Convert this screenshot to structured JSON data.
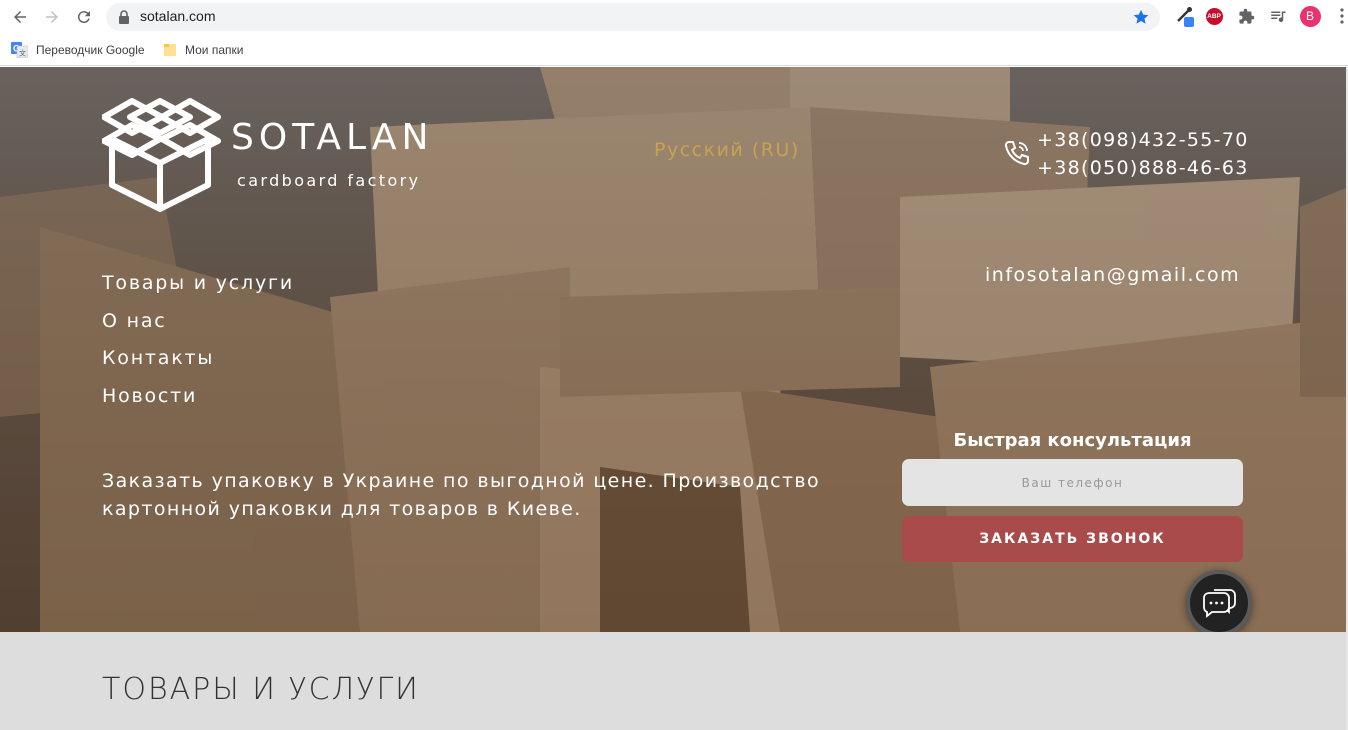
{
  "browser": {
    "url": "sotalan.com",
    "avatar_letter": "B",
    "abp_label": "ABP",
    "bookmarks": [
      {
        "label": "Переводчик Google",
        "icon": "google-translate-icon"
      },
      {
        "label": "Мои папки",
        "icon": "folder-icon"
      }
    ]
  },
  "site": {
    "logo_name": "SOTALAN",
    "logo_tagline": "cardboard factory",
    "language": "Русский (RU)",
    "phones": [
      "+38(098)432-55-70",
      "+38(050)888-46-63"
    ],
    "email": "infosotalan@gmail.com",
    "menu": [
      "Товары и услуги",
      "О нас",
      "Контакты",
      "Новости"
    ],
    "tagline": "Заказать упаковку в Украине по выгодной цене. Производство картонной упаковки для товаров в Киеве.",
    "consult": {
      "title": "Быстрая консультация",
      "phone_placeholder": "Ваш телефон",
      "button": "ЗАКАЗАТЬ ЗВОНОК"
    },
    "products_title": "ТОВАРЫ И УСЛУГИ"
  },
  "colors": {
    "accent_gold": "#c9a24e",
    "button_red": "#a84b4a",
    "chrome_star": "#1a73e8",
    "avatar_pink": "#e8336f"
  }
}
